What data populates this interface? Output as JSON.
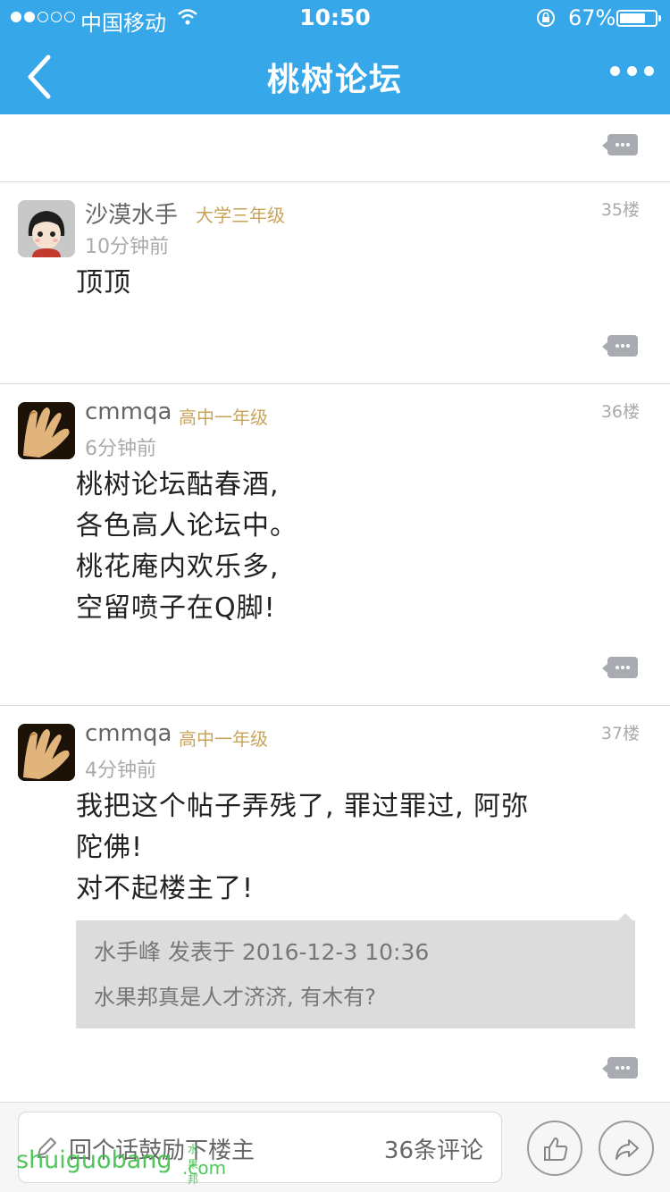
{
  "status_bar": {
    "carrier": "中国移动",
    "time": "10:50",
    "battery": "67%"
  },
  "nav": {
    "title": "桃树论坛"
  },
  "posts": [
    {
      "username": "沙漠水手",
      "grade": "大学三年级",
      "time": "10分钟前",
      "floor": "35楼",
      "lines": [
        "顶顶"
      ]
    },
    {
      "username": "cmmqa",
      "grade": "高中一年级",
      "time": "6分钟前",
      "floor": "36楼",
      "lines": [
        "桃树论坛酤春酒,",
        "各色高人论坛中。",
        "桃花庵内欢乐多,",
        "空留喷子在Q脚!"
      ]
    },
    {
      "username": "cmmqa",
      "grade": "高中一年级",
      "time": "4分钟前",
      "floor": "37楼",
      "lines": [
        "我把这个帖子弄残了, 罪过罪过, 阿弥",
        "陀佛!",
        "对不起楼主了!"
      ],
      "quote": {
        "header": "水手峰 发表于 2016-12-3 10:36",
        "text": "水果邦真是人才济济, 有木有?"
      }
    }
  ],
  "bottom_bar": {
    "placeholder": "回个话鼓励下楼主",
    "comment_count": "36条评论"
  },
  "watermark": {
    "text": "shuiguobang",
    "small": "水果邦",
    "suffix": ".com"
  },
  "icons": [
    "back-icon",
    "more-icon",
    "reply-icon",
    "pencil-icon",
    "thumbs-up-icon",
    "share-icon",
    "wifi-icon",
    "lock-rotation-icon",
    "battery-icon"
  ],
  "colors": {
    "nav": "#36a8ea",
    "grade": "#c8a45a",
    "watermark": "#3cc24a"
  }
}
